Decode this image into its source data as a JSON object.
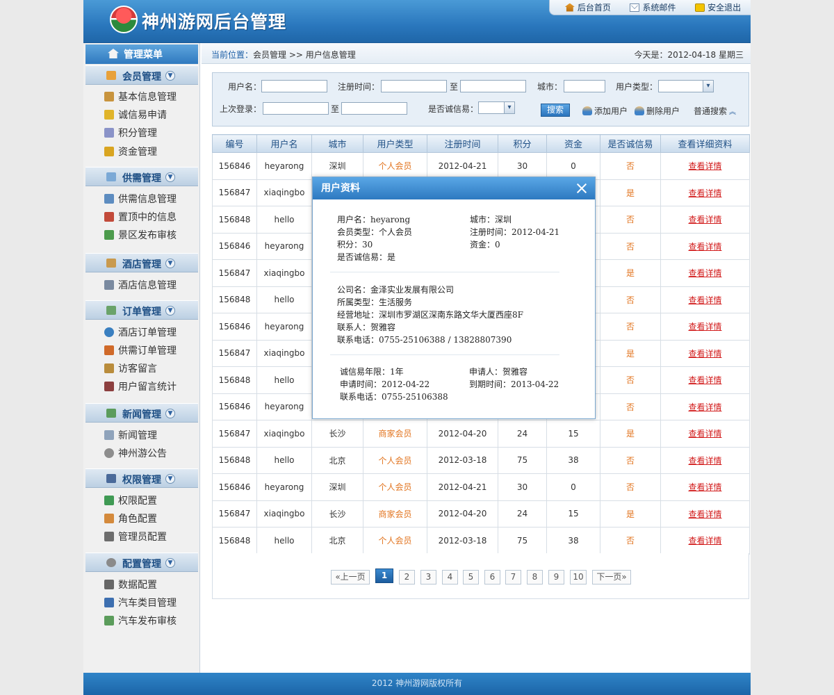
{
  "header": {
    "site_title": "神州游网后台管理",
    "links": [
      "后台首页",
      "系统邮件",
      "安全退出"
    ]
  },
  "sidebar": {
    "title": "管理菜单",
    "groups": [
      {
        "label": "会员管理",
        "items": [
          "基本信息管理",
          "诚信易申请",
          "积分管理",
          "资金管理"
        ]
      },
      {
        "label": "供需管理",
        "items": [
          "供需信息管理",
          "置顶中的信息",
          "景区发布审核"
        ]
      },
      {
        "label": "酒店管理",
        "items": [
          "酒店信息管理"
        ]
      },
      {
        "label": "订单管理",
        "items": [
          "酒店订单管理",
          "供需订单管理",
          "访客留言",
          "用户留言统计"
        ]
      },
      {
        "label": "新闻管理",
        "items": [
          "新闻管理",
          "神州游公告"
        ]
      },
      {
        "label": "权限管理",
        "items": [
          "权限配置",
          "角色配置",
          "管理员配置"
        ]
      },
      {
        "label": "配置管理",
        "items": [
          "数据配置",
          "汽车类目管理",
          "汽车发布审核"
        ]
      }
    ]
  },
  "crumb": {
    "label": "当前位置：",
    "path": "会员管理 >> 用户信息管理",
    "today": "今天是：2012-04-18 星期三"
  },
  "search": {
    "username": "用户名：",
    "regtime": "注册时间：",
    "to": "至",
    "city": "城市：",
    "usertype": "用户类型：",
    "lastlogin": "上次登录：",
    "credit": "是否诚信易：",
    "search_btn": "搜索",
    "add_user": "添加用户",
    "del_user": "删除用户",
    "normal_search": "普通搜索"
  },
  "table": {
    "headers": [
      "编号",
      "用户名",
      "城市",
      "用户类型",
      "注册时间",
      "积分",
      "资金",
      "是否诚信易",
      "查看详细资料"
    ],
    "link": "查看详情",
    "rows": [
      [
        "156846",
        "heyarong",
        "深圳",
        "个人会员",
        "2012-04-21",
        "30",
        "0",
        "否"
      ],
      [
        "156847",
        "xiaqingbo",
        "",
        "",
        "",
        "",
        "",
        "是"
      ],
      [
        "156848",
        "hello",
        "",
        "",
        "",
        "",
        "",
        "否"
      ],
      [
        "156846",
        "heyarong",
        "",
        "",
        "",
        "",
        "",
        "否"
      ],
      [
        "156847",
        "xiaqingbo",
        "",
        "",
        "",
        "",
        "",
        "是"
      ],
      [
        "156848",
        "hello",
        "",
        "",
        "",
        "",
        "",
        "否"
      ],
      [
        "156846",
        "heyarong",
        "",
        "",
        "",
        "",
        "",
        "否"
      ],
      [
        "156847",
        "xiaqingbo",
        "",
        "",
        "",
        "",
        "",
        "是"
      ],
      [
        "156848",
        "hello",
        "",
        "",
        "",
        "",
        "",
        "否"
      ],
      [
        "156846",
        "heyarong",
        "",
        "",
        "",
        "",
        "",
        "否"
      ],
      [
        "156847",
        "xiaqingbo",
        "长沙",
        "商家会员",
        "2012-04-20",
        "24",
        "15",
        "是"
      ],
      [
        "156848",
        "hello",
        "北京",
        "个人会员",
        "2012-03-18",
        "75",
        "38",
        "否"
      ],
      [
        "156846",
        "heyarong",
        "深圳",
        "个人会员",
        "2012-04-21",
        "30",
        "0",
        "否"
      ],
      [
        "156847",
        "xiaqingbo",
        "长沙",
        "商家会员",
        "2012-04-20",
        "24",
        "15",
        "是"
      ],
      [
        "156848",
        "hello",
        "北京",
        "个人会员",
        "2012-03-18",
        "75",
        "38",
        "否"
      ]
    ]
  },
  "pager": {
    "prev": "«上一页",
    "next": "下一页»",
    "pages": [
      "1",
      "2",
      "3",
      "4",
      "5",
      "6",
      "7",
      "8",
      "9",
      "10"
    ],
    "current": "1"
  },
  "footer": "2012 神州游网版权所有",
  "modal": {
    "title": "用户资料",
    "username": "用户名：heyarong",
    "city": "城市：深圳",
    "member_type": "会员类型：个人会员",
    "reg_time": "注册时间：2012-04-21",
    "points": "积分：30",
    "funds": "资金：0",
    "credit": "是否诚信易：是",
    "company": "公司名：金泽实业发展有限公司",
    "category": "所属类型：生活服务",
    "address": "经营地址：深圳市罗湖区深南东路文华大厦西座8F",
    "contact": "联系人：贺雅容",
    "phone": "联系电话：0755-25106388 / 13828807390",
    "credit_years": "诚信易年限：1年",
    "applicant": "申请人：贺雅容",
    "apply_time": "申请时间：2012-04-22",
    "expire_time": "到期时间：2013-04-22",
    "phone2": "联系电话：0755-25106388"
  }
}
